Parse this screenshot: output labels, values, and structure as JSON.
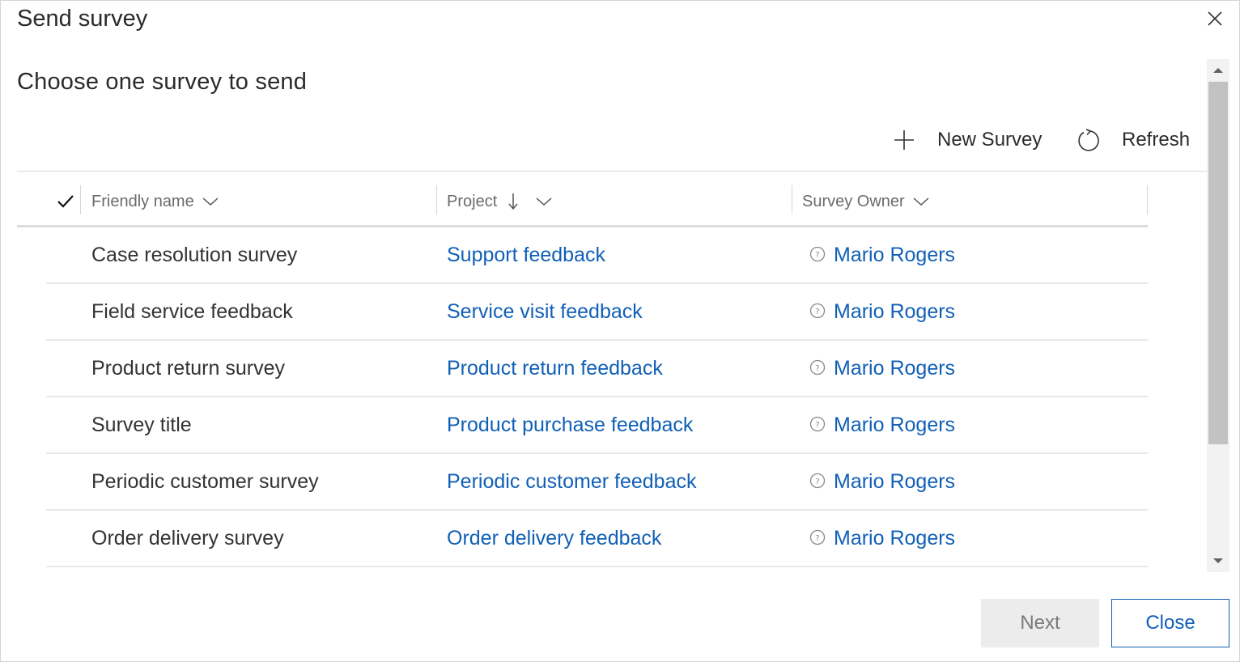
{
  "dialog": {
    "title": "Send survey",
    "subtitle": "Choose one survey to send",
    "close_icon": "close-icon"
  },
  "commands": {
    "new_survey_label": "New Survey",
    "new_survey_icon": "plus-icon",
    "refresh_label": "Refresh",
    "refresh_icon": "refresh-icon"
  },
  "table": {
    "columns": {
      "friendly_name": "Friendly name",
      "project": "Project",
      "survey_owner": "Survey Owner"
    },
    "project_sort": "descending",
    "rows": [
      {
        "name": "Case resolution survey",
        "project": "Support feedback",
        "owner": "Mario Rogers"
      },
      {
        "name": "Field service feedback",
        "project": "Service visit feedback",
        "owner": "Mario Rogers"
      },
      {
        "name": "Product return survey",
        "project": "Product return feedback",
        "owner": "Mario Rogers"
      },
      {
        "name": "Survey title",
        "project": "Product purchase feedback",
        "owner": "Mario Rogers"
      },
      {
        "name": "Periodic customer survey",
        "project": "Periodic customer feedback",
        "owner": "Mario Rogers"
      },
      {
        "name": "Order delivery survey",
        "project": "Order delivery feedback",
        "owner": "Mario Rogers"
      }
    ]
  },
  "footer": {
    "next_label": "Next",
    "close_label": "Close"
  },
  "colors": {
    "link": "#1160b7",
    "disabled_button_bg": "#ececec",
    "text": "#333333"
  }
}
